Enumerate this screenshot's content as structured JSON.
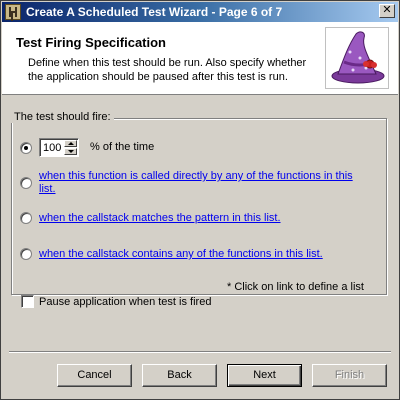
{
  "window": {
    "title": "Create A Scheduled Test Wizard - Page 6 of 7",
    "close_glyph": "✕"
  },
  "header": {
    "title": "Test Firing Specification",
    "description": "Define when this test should be run. Also specify whether the application should be paused after this test is run.",
    "image_icon": "wizard-hat-icon"
  },
  "group": {
    "legend": "The test should fire:",
    "options": [
      {
        "type": "percent",
        "selected": true,
        "value": "100",
        "label": "% of the time"
      },
      {
        "type": "link",
        "selected": false,
        "label": "when this function is called directly by any of the functions in this list."
      },
      {
        "type": "link",
        "selected": false,
        "label": "when the callstack matches the pattern in this list."
      },
      {
        "type": "link",
        "selected": false,
        "label": "when the callstack contains any of the functions in this list."
      }
    ],
    "note": "* Click on link to define a list"
  },
  "pause": {
    "label": "Pause application when test is fired",
    "checked": false
  },
  "buttons": {
    "cancel": "Cancel",
    "back": "Back",
    "next": "Next",
    "finish": "Finish"
  },
  "colors": {
    "link": "#0000ee",
    "titlebar_start": "#0a246a",
    "titlebar_end": "#a6caf0"
  }
}
